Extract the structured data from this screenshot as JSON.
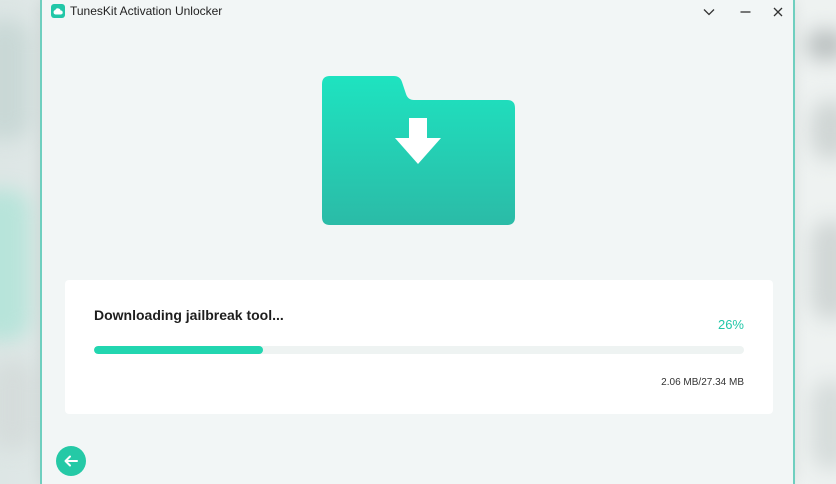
{
  "window": {
    "title": "TunesKit Activation Unlocker",
    "controls": {
      "menu_icon": "chevron-down-icon",
      "minimize_icon": "minimize-icon",
      "close_icon": "close-icon"
    }
  },
  "graphic": {
    "icon": "folder-download-icon",
    "colors": {
      "folder_top": "#1ee3c0",
      "folder_bottom": "#2bbba7",
      "arrow": "#ffffff"
    }
  },
  "progress": {
    "status_label": "Downloading jailbreak tool...",
    "percent_label": "26%",
    "fraction": 0.26,
    "size_label": "2.06 MB/27.34 MB",
    "colors": {
      "fill": "#22d6b0",
      "track": "#eef3f2",
      "percent_text": "#22c7a8"
    }
  },
  "navigation": {
    "back_icon": "arrow-left-icon"
  },
  "theme": {
    "accent": "#22c7a8"
  }
}
